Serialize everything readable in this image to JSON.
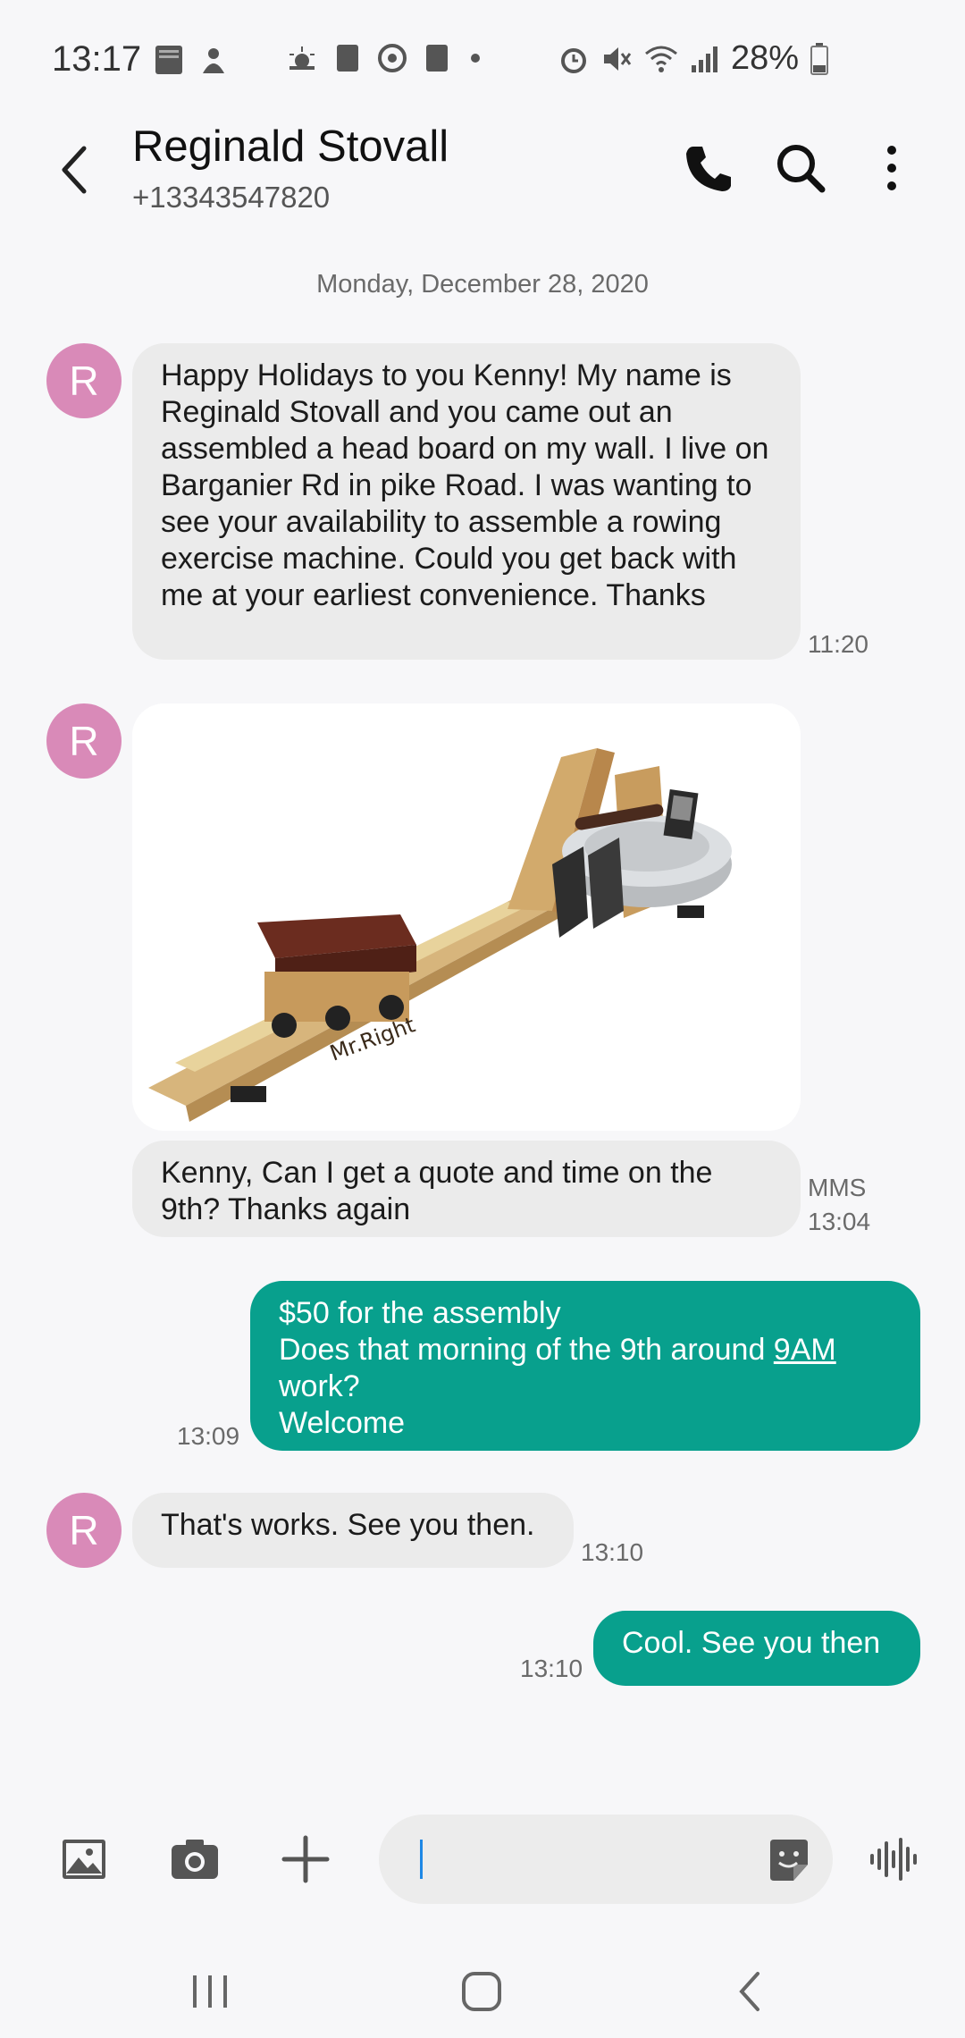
{
  "status": {
    "time": "13:17",
    "battery": "28%"
  },
  "header": {
    "name": "Reginald Stovall",
    "number": "+13343547820"
  },
  "date_separator": "Monday, December 28, 2020",
  "messages": [
    {
      "avatar": "R",
      "text": "Happy Holidays to you Kenny! My name is Reginald Stovall and you came out an assembled a head board on my wall. I live on Barganier Rd in pike Road. I was wanting to see your availability to assemble a rowing exercise machine. Could you get back with me at your earliest convenience. Thanks",
      "time": "11:20"
    },
    {
      "avatar": "R",
      "image_text": "Mr.Right",
      "caption": "Kenny, Can I get a quote and time on the 9th?  Thanks again",
      "type": "MMS",
      "time": "13:04"
    },
    {
      "line1": "$50 for the assembly",
      "line2_pre": "Does that morning of the 9th around ",
      "line2_link": "9AM",
      "line3": "work?",
      "line4": "Welcome",
      "time": "13:09"
    },
    {
      "avatar": "R",
      "text": "That's works. See you then.",
      "time": "13:10"
    },
    {
      "text": "Cool. See you then",
      "time": "13:10"
    }
  ],
  "colors": {
    "outgoing": "#08a08d",
    "incoming": "#ebebeb",
    "avatar": "#d98ab8"
  }
}
